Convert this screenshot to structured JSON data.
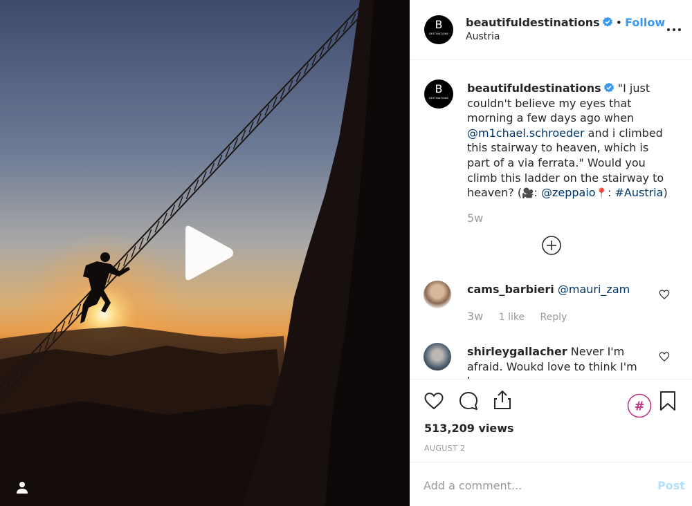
{
  "post": {
    "author": "beautifuldestinations",
    "avatar_letter": "B",
    "avatar_sub": "DESTINATIONS",
    "follow_label": "Follow",
    "location": "Austria",
    "separator": "•"
  },
  "caption": {
    "username": "beautifuldestinations",
    "text_1": " \"I just couldn't believe my eyes that morning a few days ago when ",
    "mention_1": "@m1chael.schroeder",
    "text_2": " and i climbed this stairway to heaven, which is part of a via ferrata.\" Would you climb this ladder on the stairway to heaven? (",
    "emoji_camera": "🎥",
    "text_3": ": ",
    "mention_2": "@zeppaio",
    "emoji_pin": "📍",
    "text_4": ": ",
    "hashtag": "#Austria",
    "text_5": ")",
    "time_ago": "5w"
  },
  "comments": [
    {
      "username": "cams_barbieri",
      "mention": "@mauri_zam",
      "time_ago": "3w",
      "likes": "1 like",
      "reply_label": "Reply"
    },
    {
      "username": "shirleygallacher",
      "text": " Never I'm afraid. Woukd love to think I'm brave"
    }
  ],
  "stats": {
    "views": "513,209 views",
    "date": "AUGUST 2"
  },
  "composer": {
    "placeholder": "Add a comment...",
    "post_label": "Post"
  },
  "icons": {
    "verified": "verified-badge-icon",
    "more": "more-options-icon",
    "load_more": "plus-circle-icon",
    "like": "heart-icon",
    "comment": "comment-bubble-icon",
    "share": "share-icon",
    "hashtag": "hashtag-icon",
    "save": "bookmark-icon",
    "play": "play-icon",
    "tag_user": "user-tag-icon"
  },
  "colors": {
    "link_blue": "#3897f0",
    "mention_blue": "#003569",
    "muted": "#999999",
    "hashtag_magenta": "#c13584"
  }
}
